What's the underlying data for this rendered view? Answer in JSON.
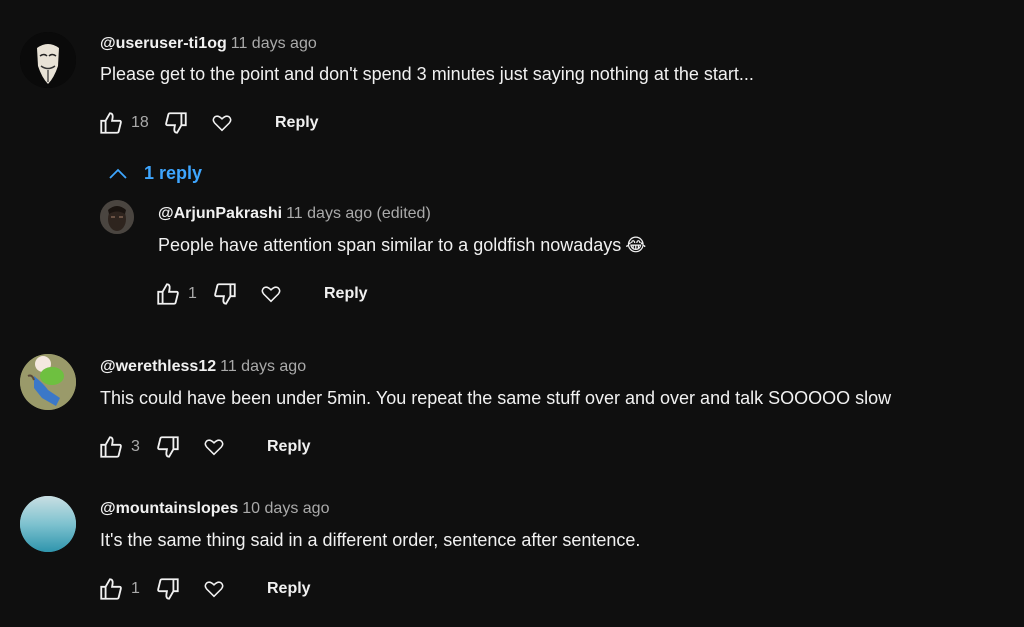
{
  "comments": [
    {
      "author": "@useruser-ti1og",
      "time": "11 days ago",
      "text": "Please get to the point and don't spend 3 minutes just saying nothing at the start...",
      "likes": "18",
      "reply_label": "Reply",
      "avatar_icon": "mask-avatar",
      "replies_toggle": "1 reply",
      "replies": [
        {
          "author": "@ArjunPakrashi",
          "time": "11 days ago (edited)",
          "text": "People have attention span similar to a goldfish nowadays",
          "emoji": "😂",
          "likes": "1",
          "reply_label": "Reply",
          "avatar_icon": "portrait-avatar"
        }
      ]
    },
    {
      "author": "@werethless12",
      "time": "11 days ago",
      "text": "This could have been under 5min. You repeat the same stuff over and over and talk SOOOOO slow",
      "likes": "3",
      "reply_label": "Reply",
      "avatar_icon": "cartoon-avatar"
    },
    {
      "author": "@mountainslopes",
      "time": "10 days ago",
      "text": "It's the same thing said in a different order, sentence after sentence.",
      "likes": "1",
      "reply_label": "Reply",
      "avatar_icon": "blue-gradient-avatar"
    }
  ],
  "colors": {
    "background": "#0f0f0f",
    "text_primary": "#f1f1f1",
    "text_secondary": "#aaaaaa",
    "link_blue": "#3ea6ff"
  }
}
